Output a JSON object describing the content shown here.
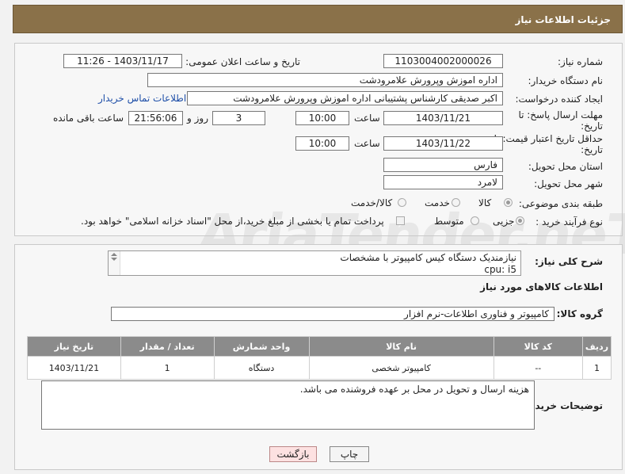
{
  "header": {
    "title": "جزئیات اطلاعات نیاز"
  },
  "form": {
    "need_number": {
      "label": "شماره نیاز:",
      "value": "1103004002000026"
    },
    "announce": {
      "label": "تاریخ و ساعت اعلان عمومی:",
      "value": "1403/11/17 - 11:26"
    },
    "buyer_org": {
      "label": "نام دستگاه خریدار:",
      "value": "اداره اموزش وپرورش علامرودشت"
    },
    "creator": {
      "label": "ایجاد کننده درخواست:",
      "value": "اکبر صدیقی کارشناس پشتیبانی اداره اموزش وپرورش علامرودشت",
      "contact_link": "اطلاعات تماس خریدار"
    },
    "reply_deadline": {
      "label_line1": "مهلت ارسال پاسخ: تا",
      "label_line2": "تاریخ:",
      "date": "1403/11/21",
      "time_label": "ساعت",
      "time": "10:00",
      "days": "3",
      "days_label": "روز و",
      "remaining": "21:56:06",
      "remaining_label": "ساعت باقی مانده"
    },
    "price_validity": {
      "label_line1": "حداقل تاریخ اعتبار قیمت: تا",
      "label_line2": "تاریخ:",
      "date": "1403/11/22",
      "time_label": "ساعت",
      "time": "10:00"
    },
    "province": {
      "label": "استان محل تحویل:",
      "value": "فارس"
    },
    "city": {
      "label": "شهر محل تحویل:",
      "value": "لامرد"
    },
    "category": {
      "label": "طبقه بندی موضوعی:",
      "options": [
        "کالا",
        "خدمت",
        "کالا/خدمت"
      ],
      "selected": "کالا"
    },
    "process": {
      "label": "نوع فرآیند خرید :",
      "options": [
        "جزیی",
        "متوسط"
      ],
      "selected": "جزیی",
      "payment_note": "پرداخت تمام یا بخشی از مبلغ خرید،از محل \"اسناد خزانه اسلامی\" خواهد بود."
    }
  },
  "description": {
    "label": "شرح کلی نیاز:",
    "line1": "نیازمندیک دستگاه کیس کامپیوتر با مشخصات",
    "line2": "cpu: i5"
  },
  "goods_info": {
    "title": "اطلاعات کالاهای مورد نیاز"
  },
  "goods_group": {
    "label": "گروه کالا:",
    "value": "کامپیوتر و فناوری اطلاعات-نرم افزار"
  },
  "table": {
    "headers": [
      "ردیف",
      "کد کالا",
      "نام کالا",
      "واحد شمارش",
      "تعداد / مقدار",
      "تاریخ نیاز"
    ],
    "rows": [
      [
        "1",
        "--",
        "کامپیوتر شخصی",
        "دستگاه",
        "1",
        "1403/11/21"
      ]
    ]
  },
  "buyer_notes": {
    "label": "توضیحات خریدار:",
    "text": "هزینه ارسال و تحویل در محل بر عهده فروشنده می باشد."
  },
  "buttons": {
    "print": "چاپ",
    "back": "بازگشت"
  },
  "watermark": "AriaTender.neT"
}
